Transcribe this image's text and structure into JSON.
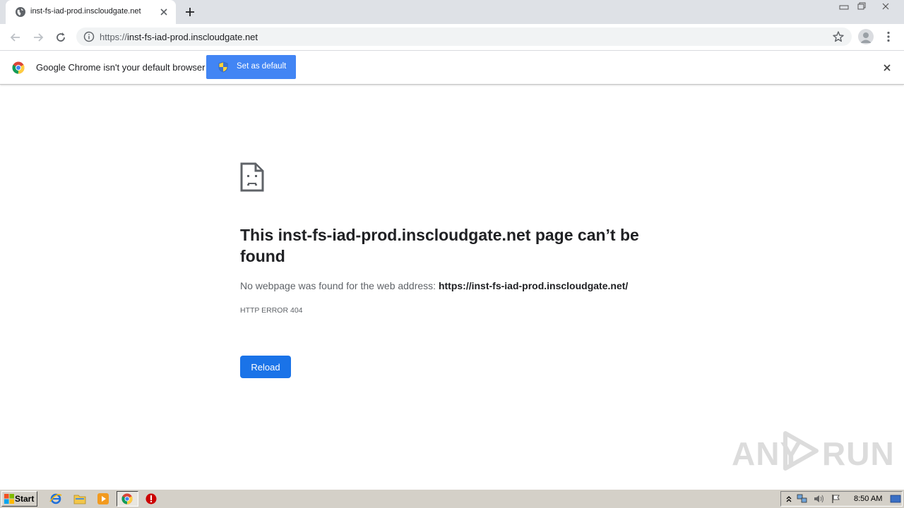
{
  "tab": {
    "title": "inst-fs-iad-prod.inscloudgate.net",
    "favicon": "globe-icon"
  },
  "toolbar": {
    "url_scheme": "https://",
    "url_host": "inst-fs-iad-prod.inscloudgate.net"
  },
  "infobar": {
    "message": "Google Chrome isn't your default browser",
    "set_default_label": "Set as default"
  },
  "error_page": {
    "title": "This inst-fs-iad-prod.inscloudgate.net page can’t be found",
    "desc_prefix": "No webpage was found for the web address: ",
    "desc_url": "https://inst-fs-iad-prod.inscloudgate.net/",
    "error_code": "HTTP ERROR 404",
    "reload_label": "Reload"
  },
  "watermark": {
    "text_left": "ANY",
    "text_right": "RUN"
  },
  "taskbar": {
    "start_label": "Start",
    "clock": "8:50 AM"
  },
  "colors": {
    "accent": "#1a73e8",
    "infobar_button": "#4285f4",
    "tabstrip": "#dee1e6",
    "omnibox": "#f1f3f4",
    "taskbar": "#d4d0c8"
  }
}
